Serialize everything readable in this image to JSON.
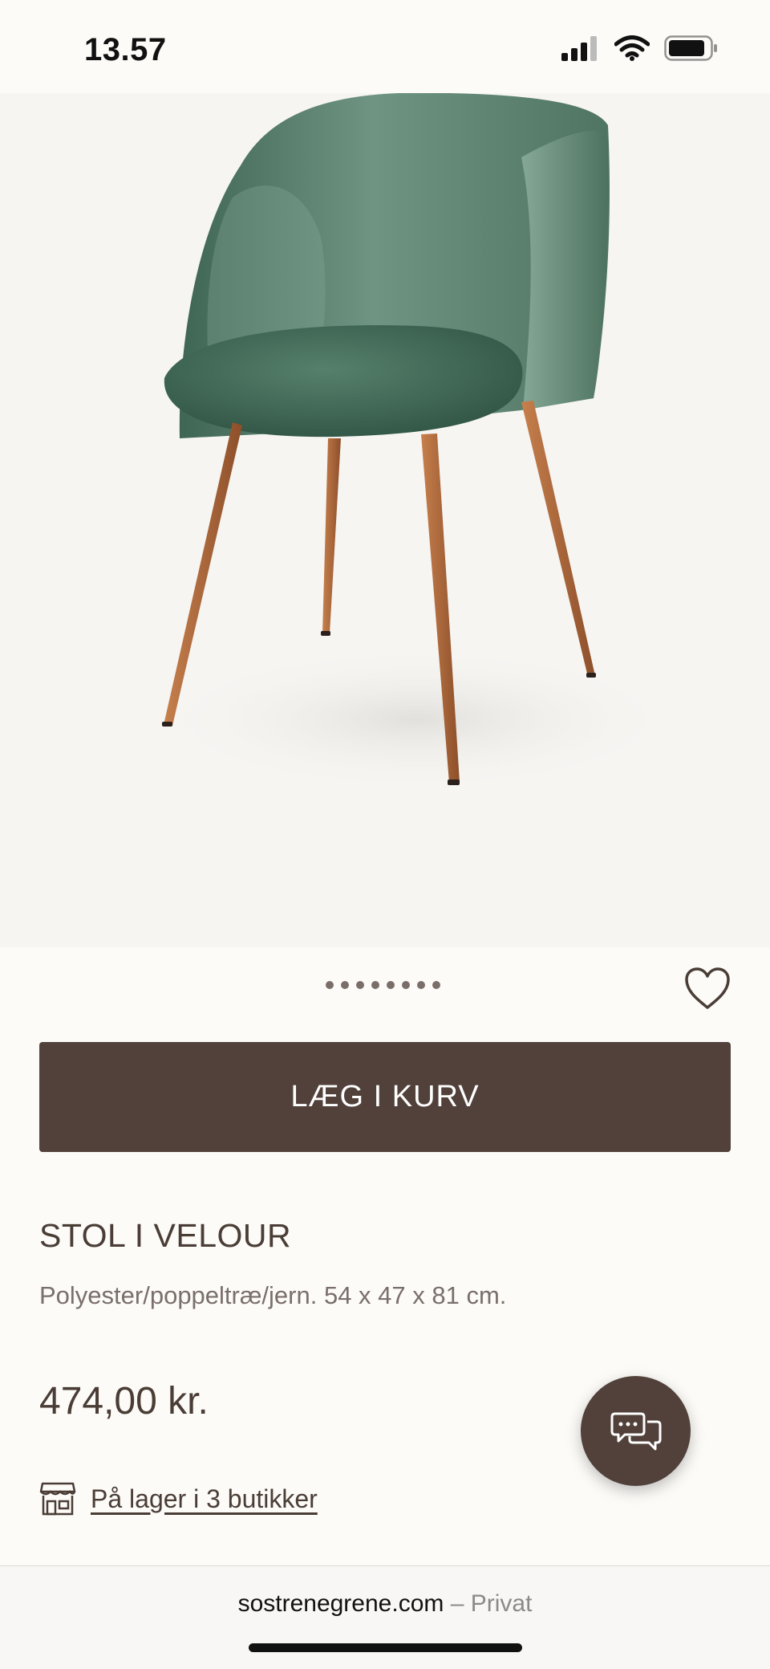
{
  "status_bar": {
    "time": "13.57"
  },
  "product": {
    "add_to_cart_label": "LÆG I KURV",
    "title": "STOL I VELOUR",
    "description": "Polyester/poppeltræ/jern. 54 x 47 x 81 cm.",
    "price": "474,00 kr.",
    "stock_text": "På lager i 3 butikker",
    "image_count": 8
  },
  "browser": {
    "domain": "sostrenegrene.com",
    "separator": "–",
    "mode": "Privat"
  },
  "colors": {
    "accent": "#51413a",
    "text": "#4a3d36",
    "background": "#fcfbf8",
    "chair_green": "#4e7561",
    "leg_wood": "#b0683a"
  },
  "icons": [
    "signal-icon",
    "wifi-icon",
    "battery-icon",
    "heart-icon",
    "chat-icon",
    "store-icon"
  ]
}
